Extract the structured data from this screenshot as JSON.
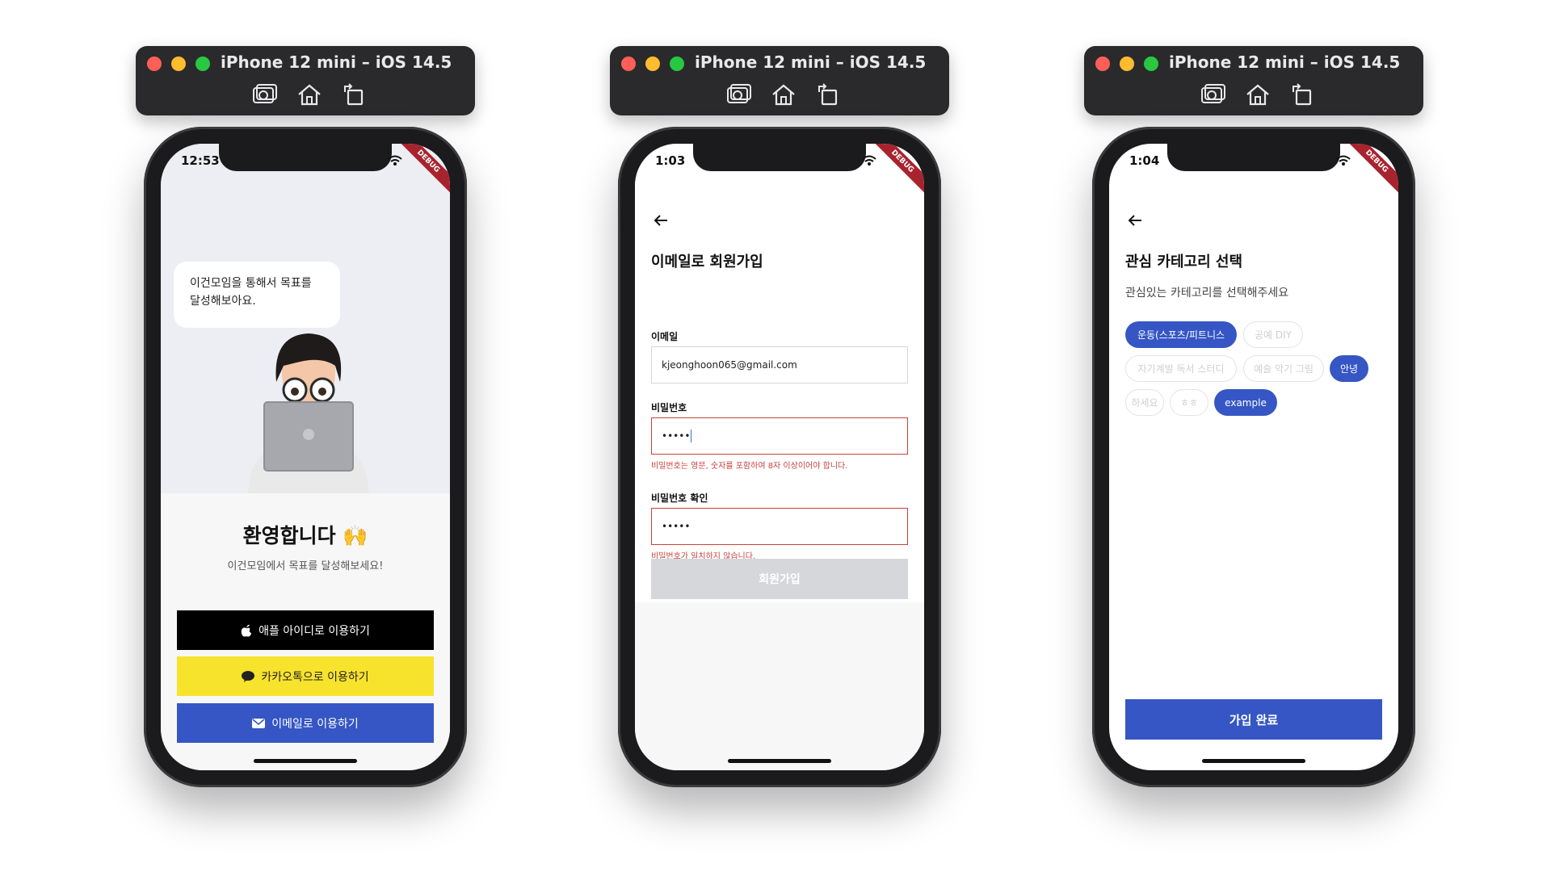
{
  "simulators": [
    {
      "title": "iPhone 12 mini – iOS 14.5",
      "time": "12:53"
    },
    {
      "title": "iPhone 12 mini – iOS 14.5",
      "time": "1:03"
    },
    {
      "title": "iPhone 12 mini – iOS 14.5",
      "time": "1:04"
    }
  ],
  "debug_banner": "DEBUG",
  "toolbar_icons": [
    "screenshot-icon",
    "home-icon",
    "rotate-icon"
  ],
  "welcome": {
    "bubble_line1": "이건모임을 통해서 목표를",
    "bubble_line2": "달성해보아요.",
    "title": "환영합니다",
    "title_emoji": "🙌",
    "subtitle": "이건모임에서 목표를 달성해보세요!",
    "apple_label": "애플 아이디로 이용하기",
    "kakao_label": "카카오톡으로 이용하기",
    "email_label": "이메일로 이용하기"
  },
  "signup": {
    "title": "이메일로 회원가입",
    "email_label": "이메일",
    "email_value": "kjeonghoon065@gmail.com",
    "password_label": "비밀번호",
    "password_value": "•••••",
    "password_error": "비밀번호는 영문, 숫자를 포함하여 8자 이상이어야 합니다.",
    "confirm_label": "비밀번호 확인",
    "confirm_value": "•••••",
    "confirm_error": "비밀번호가 일치하지 않습니다.",
    "submit_label": "회원가입"
  },
  "category": {
    "title": "관심 카테고리 선택",
    "subtitle": "관심있는 카테고리를 선택해주세요",
    "chips": [
      {
        "label": "운동(스포츠/피트니스",
        "selected": true
      },
      {
        "label": "공예 DIY",
        "selected": false
      },
      {
        "label": "자기계발 독서 스터디",
        "selected": false
      },
      {
        "label": "예술 악기 그림",
        "selected": false
      },
      {
        "label": "안녕",
        "selected": true
      },
      {
        "label": "하세요",
        "selected": false
      },
      {
        "label": "ㅎㅎ",
        "selected": false
      },
      {
        "label": "example",
        "selected": true
      }
    ],
    "complete_label": "가입 완료"
  },
  "colors": {
    "primary": "#3556c4",
    "kakao": "#f7e32c",
    "error": "#c9413b",
    "disabled": "#d6d7db",
    "simulator_bar": "#2a2a2d"
  }
}
